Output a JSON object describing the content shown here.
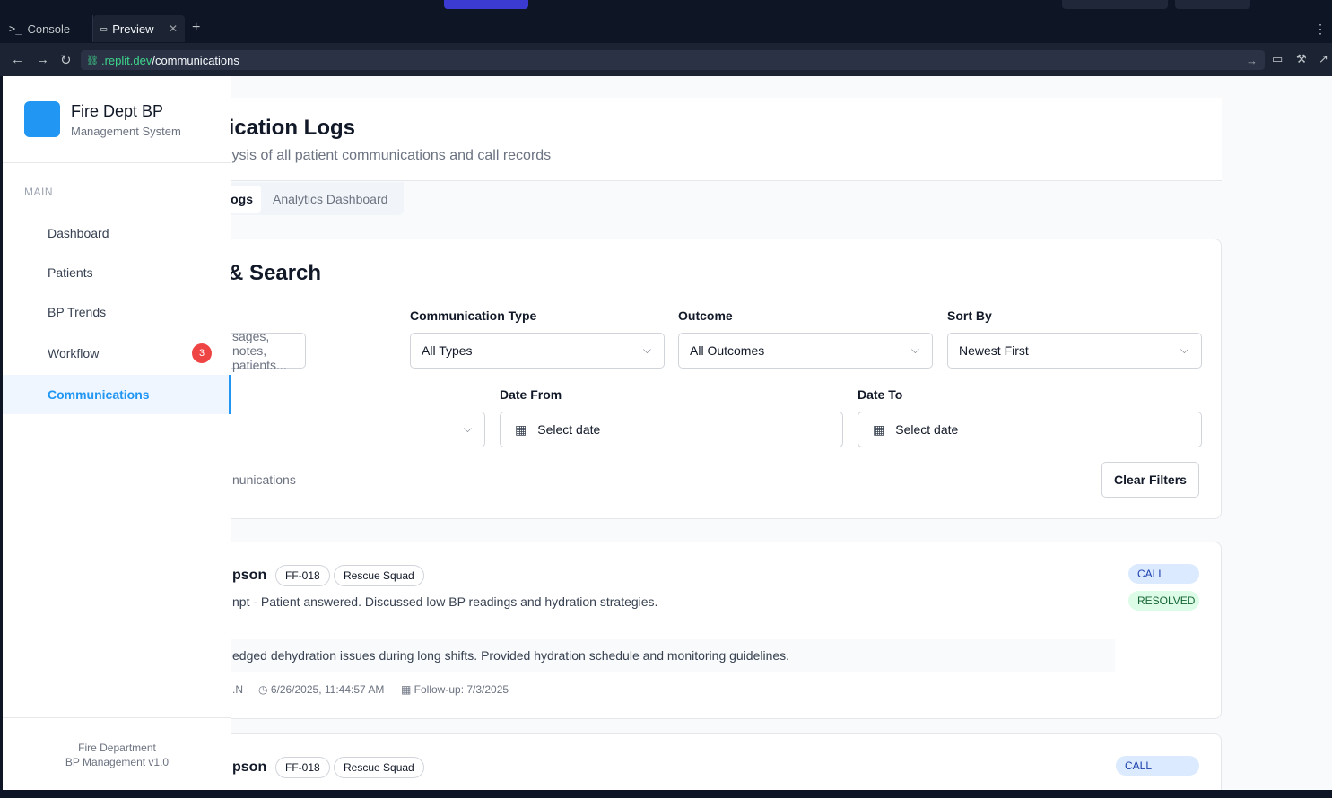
{
  "ide": {
    "tabs": [
      {
        "icon": ">_",
        "label": "Console"
      },
      {
        "icon": "monitor-icon",
        "label": "Preview"
      }
    ],
    "url_host": ".replit.dev",
    "url_path": "/communications"
  },
  "sidebar": {
    "brand_title": "Fire Dept BP",
    "brand_subtitle": "Management System",
    "section_label": "MAIN",
    "items": [
      {
        "label": "Dashboard"
      },
      {
        "label": "Patients"
      },
      {
        "label": "BP Trends"
      },
      {
        "label": "Workflow",
        "badge": "3"
      },
      {
        "label": "Communications",
        "active": true
      }
    ],
    "footer_line1": "Fire Department",
    "footer_line2": "BP Management v1.0"
  },
  "header": {
    "title": "nication Logs",
    "subtitle": "alysis of all patient communications and call records"
  },
  "tabs": {
    "active": "ogs",
    "inactive": "Analytics Dashboard"
  },
  "filters": {
    "title": "& Search",
    "search_placeholder": "sages, notes, patients...",
    "type_label": "Communication Type",
    "type_value": "All Types",
    "outcome_label": "Outcome",
    "outcome_value": "All Outcomes",
    "sort_label": "Sort By",
    "sort_value": "Newest First",
    "date_from_label": "Date From",
    "date_from_placeholder": "Select date",
    "date_to_label": "Date To",
    "date_to_placeholder": "Select date",
    "count_text": "nunications",
    "clear_label": "Clear Filters"
  },
  "communications": [
    {
      "name": "pson",
      "id": "FF-018",
      "unit": "Rescue Squad",
      "description": "npt - Patient answered. Discussed low BP readings and hydration strategies.",
      "note": "edged dehydration issues during long shifts. Provided hydration schedule and monitoring guidelines.",
      "by": ".N",
      "timestamp": "6/26/2025, 11:44:57 AM",
      "followup": "Follow-up: 7/3/2025",
      "type": "CALL",
      "status": "RESOLVED"
    },
    {
      "name": "pson",
      "id": "FF-018",
      "unit": "Rescue Squad",
      "type": "CALL"
    }
  ],
  "colors": {
    "accent": "#2196f3",
    "badge_red": "#ef4444",
    "call_bg": "#dbeafe",
    "resolved_bg": "#dcfce7"
  }
}
